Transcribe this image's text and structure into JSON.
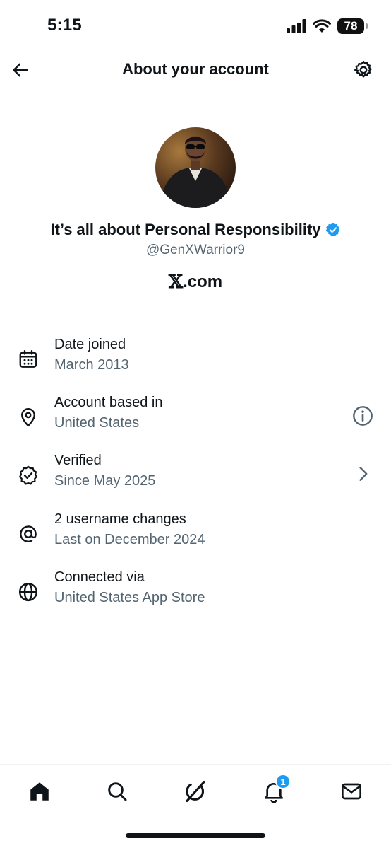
{
  "status_bar": {
    "time": "5:15",
    "battery": "78",
    "icons": [
      "signal-icon",
      "wifi-icon",
      "battery-icon"
    ]
  },
  "header": {
    "title": "About your account",
    "back_icon": "arrow-left-icon",
    "settings_icon": "gear-icon"
  },
  "profile": {
    "display_name": "It’s all about Personal Responsibility",
    "handle": "@GenXWarrior9",
    "verified": true,
    "site_mark": "𝕏",
    "site_text": ".com"
  },
  "info": {
    "items": [
      {
        "icon": "calendar-icon",
        "title": "Date joined",
        "subtitle": "March 2013"
      },
      {
        "icon": "location-pin-icon",
        "title": "Account based in",
        "subtitle": "United States",
        "trailing": "info-icon"
      },
      {
        "icon": "verified-badge-icon",
        "title": "Verified",
        "subtitle": "Since May 2025",
        "trailing": "chevron-right-icon"
      },
      {
        "icon": "at-sign-icon",
        "title": "2 username changes",
        "subtitle": "Last on December 2024"
      },
      {
        "icon": "globe-icon",
        "title": "Connected via",
        "subtitle": "United States App Store"
      }
    ]
  },
  "tab_bar": {
    "tabs": [
      "home-icon",
      "search-icon",
      "grok-icon",
      "bell-icon",
      "mail-icon"
    ],
    "notifications_badge": "1"
  },
  "colors": {
    "accent": "#1d9bf0",
    "text_primary": "#0f1419",
    "text_secondary": "#536471"
  }
}
